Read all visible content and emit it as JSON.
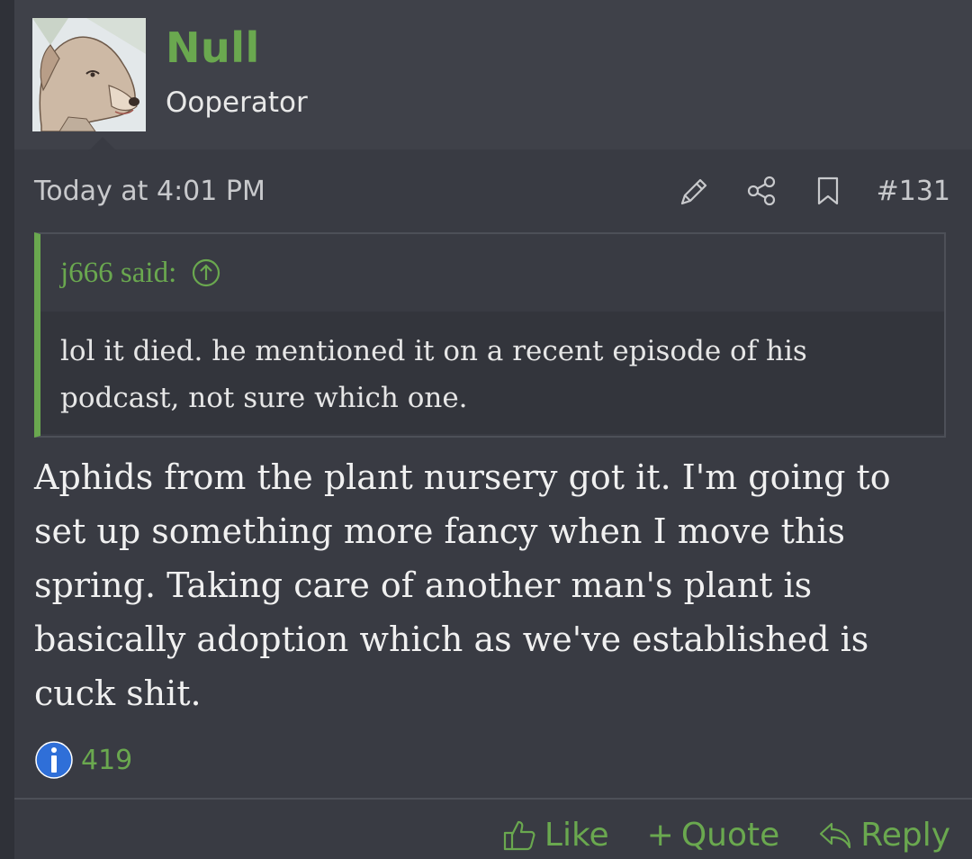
{
  "user": {
    "name": "Null",
    "title": "Ooperator"
  },
  "meta": {
    "date": "Today at 4:01 PM",
    "post_number": "#131",
    "icons": [
      "edit-icon",
      "share-icon",
      "bookmark-icon"
    ]
  },
  "quote": {
    "author": "j666 said:",
    "text": "lol it died. he mentioned it on a recent episode of his podcast, not sure which one."
  },
  "message": {
    "text": "Aphids from the plant nursery got it. I'm going to set up something more fancy when I move this spring. Taking care of another man's plant is basically adoption which as we've established is cuck shit."
  },
  "reactions": {
    "icon": "informative-icon",
    "count": "419"
  },
  "actions": {
    "like": "Like",
    "quote": "Quote",
    "reply": "Reply"
  },
  "colors": {
    "accent": "#6aa84f",
    "background": "#393b43",
    "header_background": "#3f4149",
    "text": "#f0f0f0"
  }
}
